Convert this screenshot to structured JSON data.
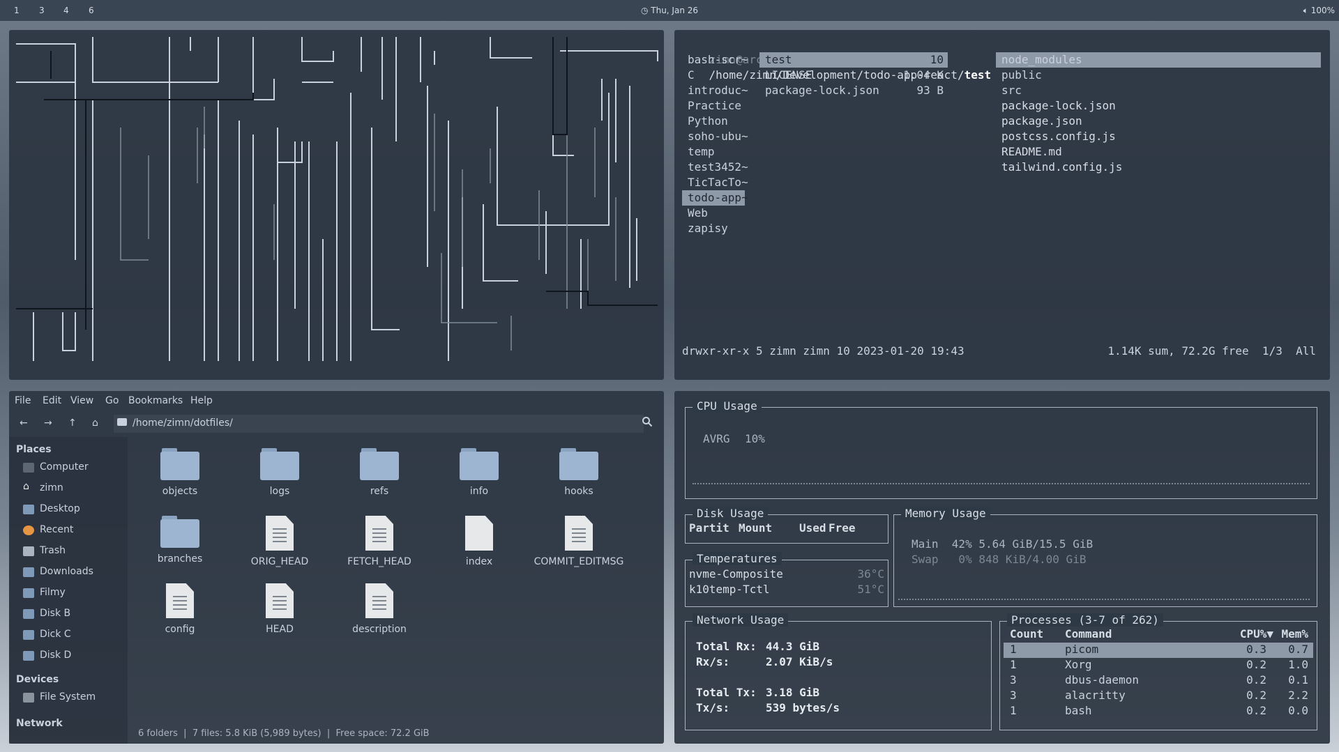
{
  "topbar": {
    "workspaces": [
      "1",
      "3",
      "4",
      "6"
    ],
    "clock_icon": "clock-icon",
    "date": "Thu, Jan 26",
    "volume_icon": "volume-icon",
    "volume": "100%"
  },
  "ranger": {
    "prompt_user": "zimn@arch",
    "prompt_path": "/home/zimn/Development/todo-app-react/",
    "prompt_current": "test",
    "left_col": [
      "bash-scr~",
      "C",
      "introduc~",
      "Practice",
      "Python",
      "soho-ubu~",
      "temp",
      "test3452~",
      "TicTacTo~",
      "todo-app~",
      "Web",
      "zapisy"
    ],
    "mid_col": [
      {
        "name": "test",
        "size": "10"
      },
      {
        "name": "LICENSE",
        "size": "1.04 K"
      },
      {
        "name": "package-lock.json",
        "size": "93 B"
      }
    ],
    "right_col": [
      "node_modules",
      "public",
      "src",
      "package-lock.json",
      "package.json",
      "postcss.config.js",
      "README.md",
      "tailwind.config.js"
    ],
    "status_left": "drwxr-xr-x 5 zimn zimn 10 2023-01-20 19:43",
    "status_right": "1.14K sum, 72.2G free  1/3  All"
  },
  "filemanager": {
    "menu": [
      "File",
      "Edit",
      "View",
      "Go",
      "Bookmarks",
      "Help"
    ],
    "path": "/home/zimn/dotfiles/",
    "places_header": "Places",
    "places": [
      "Computer",
      "zimn",
      "Desktop",
      "Recent",
      "Trash",
      "Downloads",
      "Filmy",
      "Disk B",
      "Dick C",
      "Disk D"
    ],
    "devices_header": "Devices",
    "devices": [
      "File System"
    ],
    "network_header": "Network",
    "items": [
      {
        "name": "objects",
        "type": "folder"
      },
      {
        "name": "logs",
        "type": "folder"
      },
      {
        "name": "refs",
        "type": "folder"
      },
      {
        "name": "info",
        "type": "folder"
      },
      {
        "name": "hooks",
        "type": "folder"
      },
      {
        "name": "branches",
        "type": "folder"
      },
      {
        "name": "ORIG_HEAD",
        "type": "text"
      },
      {
        "name": "FETCH_HEAD",
        "type": "text"
      },
      {
        "name": "index",
        "type": "blank"
      },
      {
        "name": "COMMIT_EDITMSG",
        "type": "text"
      },
      {
        "name": "config",
        "type": "text"
      },
      {
        "name": "HEAD",
        "type": "text"
      },
      {
        "name": "description",
        "type": "text"
      }
    ],
    "status": "6 folders  |  7 files: 5.8 KiB (5,989 bytes)  |  Free space: 72.2 GiB"
  },
  "sysmon": {
    "cpu_title": "CPU Usage",
    "cpu_label": "AVRG",
    "cpu_value": "10%",
    "disk_title": "Disk Usage",
    "disk_headers": [
      "Partit",
      "Mount",
      "Used",
      "Free"
    ],
    "temp_title": "Temperatures",
    "temps": [
      {
        "name": "nvme-Composite",
        "value": "36°C"
      },
      {
        "name": "k10temp-Tctl",
        "value": "51°C"
      }
    ],
    "mem_title": "Memory Usage",
    "mem_main": "Main  42% 5.64 GiB/15.5 GiB",
    "mem_swap": "Swap   0% 848 KiB/4.00 GiB",
    "net_title": "Network Usage",
    "net": [
      {
        "label": "Total Rx:",
        "value": "44.3 GiB"
      },
      {
        "label": "Rx/s:",
        "value": "2.07 KiB/s"
      },
      {
        "label": "Total Tx:",
        "value": "3.18 GiB"
      },
      {
        "label": "Tx/s:",
        "value": "539 bytes/s"
      }
    ],
    "proc_title": "Processes (3-7 of 262)",
    "proc_headers": [
      "Count",
      "Command",
      "CPU%▼",
      "Mem%"
    ],
    "procs": [
      {
        "count": "1",
        "cmd": "picom",
        "cpu": "0.3",
        "mem": "0.7"
      },
      {
        "count": "1",
        "cmd": "Xorg",
        "cpu": "0.2",
        "mem": "1.0"
      },
      {
        "count": "3",
        "cmd": "dbus-daemon",
        "cpu": "0.2",
        "mem": "0.1"
      },
      {
        "count": "3",
        "cmd": "alacritty",
        "cpu": "0.2",
        "mem": "2.2"
      },
      {
        "count": "1",
        "cmd": "bash",
        "cpu": "0.2",
        "mem": "0.0"
      }
    ]
  }
}
